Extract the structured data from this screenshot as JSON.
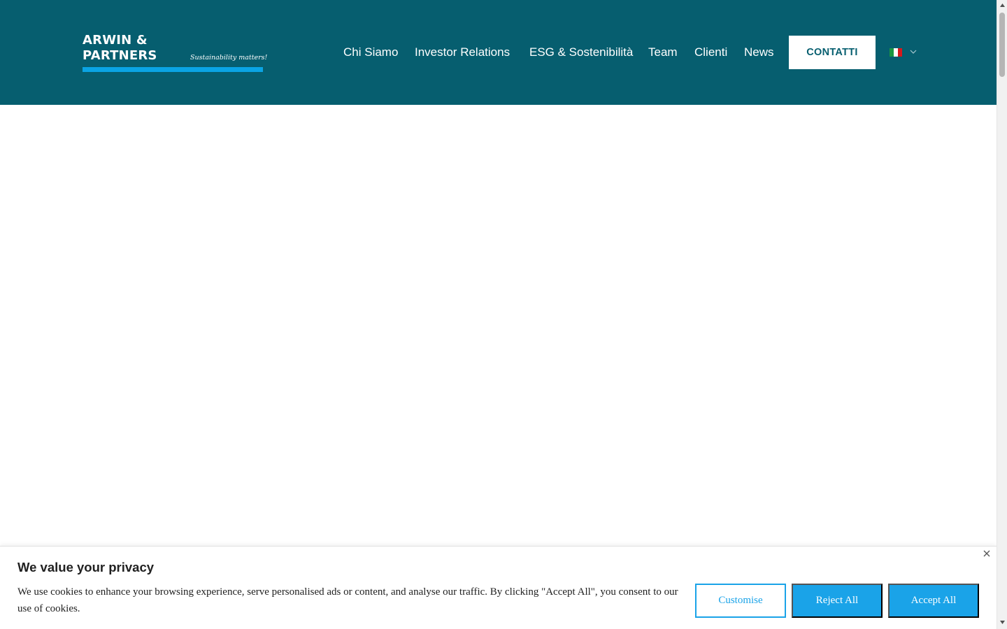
{
  "brand": {
    "name_line1": "ARWIN &",
    "name_line2": "PARTNERS",
    "tagline": "Sustainability matters!"
  },
  "nav": {
    "items": [
      {
        "label": "Chi Siamo"
      },
      {
        "label": "Investor Relations"
      },
      {
        "label": "ESG & Sostenibilità"
      },
      {
        "label": "Team"
      },
      {
        "label": "Clienti"
      },
      {
        "label": "News"
      }
    ],
    "contact_label": "CONTATTI",
    "language": {
      "icon": "italy-flag-icon",
      "dropdown_icon": "chevron-down-icon"
    }
  },
  "cookie_banner": {
    "title": "We value your privacy",
    "text": "We use cookies to enhance your browsing experience, serve personalised ads or content, and analyse our traffic. By clicking \"Accept All\", you consent to our use of cookies.",
    "customise_label": "Customise",
    "reject_label": "Reject All",
    "accept_label": "Accept All",
    "close_icon": "close-icon"
  },
  "colors": {
    "header_bg": "#065e6f",
    "accent": "#1aa3e8",
    "logo_bar": "#0aa4e4"
  }
}
